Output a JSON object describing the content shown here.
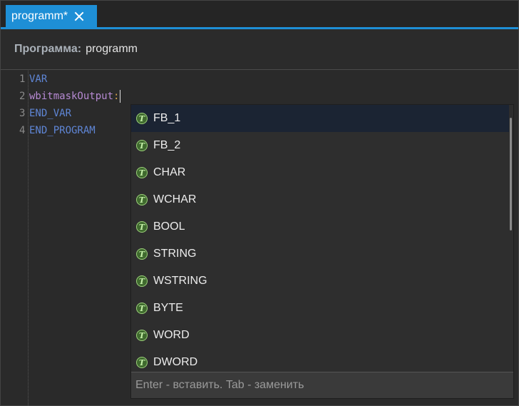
{
  "tab": {
    "title": "programm*"
  },
  "header": {
    "label": "Программа:",
    "name": "programm"
  },
  "code_lines": [
    {
      "num": "1",
      "text": "VAR"
    },
    {
      "num": "2",
      "ident": "wbitmaskOutput",
      "colon": ":"
    },
    {
      "num": "3",
      "text": "END_VAR"
    },
    {
      "num": "4",
      "text": "END_PROGRAM"
    }
  ],
  "completion": {
    "items": [
      {
        "label": "FB_1",
        "icon": "type-icon",
        "selected": true
      },
      {
        "label": "FB_2",
        "icon": "type-icon"
      },
      {
        "label": "CHAR",
        "icon": "type-icon"
      },
      {
        "label": "WCHAR",
        "icon": "type-icon"
      },
      {
        "label": "BOOL",
        "icon": "type-icon"
      },
      {
        "label": "STRING",
        "icon": "type-icon"
      },
      {
        "label": "WSTRING",
        "icon": "type-icon"
      },
      {
        "label": "BYTE",
        "icon": "type-icon"
      },
      {
        "label": "WORD",
        "icon": "type-icon"
      },
      {
        "label": "DWORD",
        "icon": "type-icon"
      }
    ],
    "icon_letter": "T",
    "footer": "Enter - вставить. Tab -  заменить"
  },
  "colors": {
    "accent": "#1e8fd6",
    "keyword": "#5f86d6",
    "identifier": "#b78ad3",
    "selected": "#1b2433"
  }
}
